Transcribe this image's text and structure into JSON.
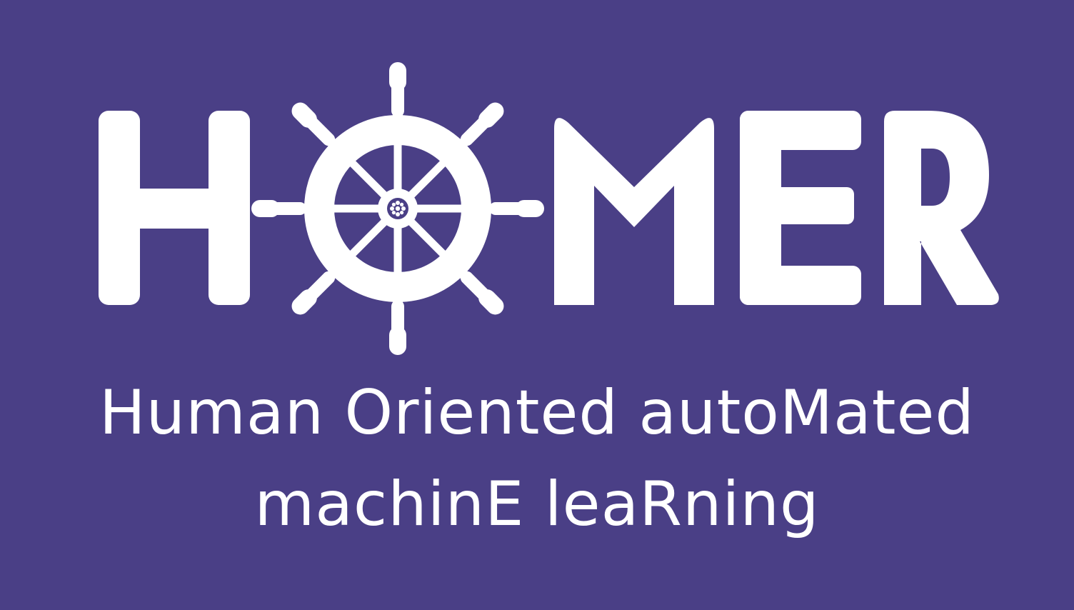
{
  "logo": {
    "wordmark": "HOMER",
    "wheel_icon": "ship-wheel-icon"
  },
  "tagline": {
    "line1": "Human Oriented autoMated",
    "line2": "machinE leaRning"
  },
  "colors": {
    "background": "#4a3f86",
    "foreground": "#ffffff"
  }
}
